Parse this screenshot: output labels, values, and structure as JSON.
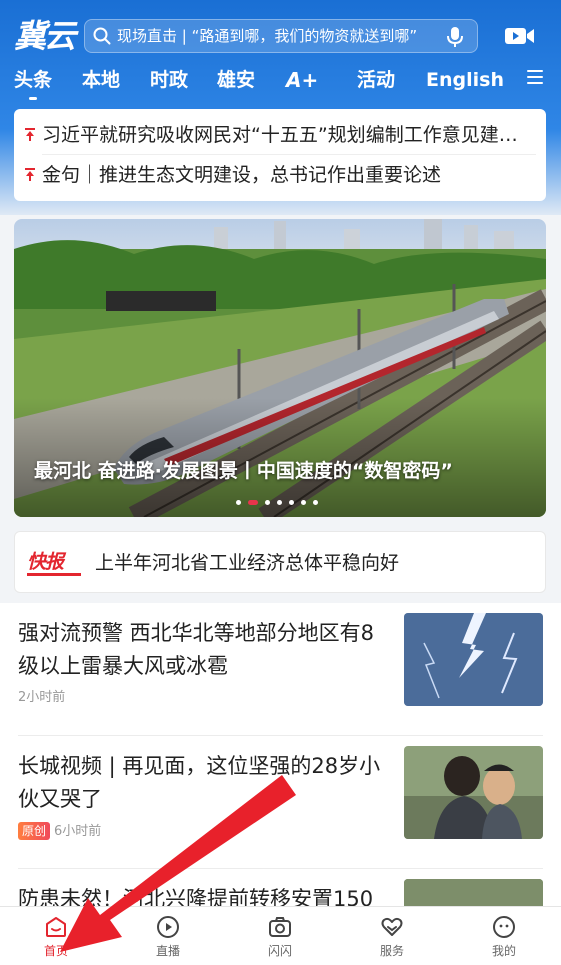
{
  "header": {
    "logo_text": "冀云",
    "search_placeholder": "现场直击 | “路通到哪，我们的物资就送到哪”",
    "tabs": [
      {
        "label": "头条",
        "active": true
      },
      {
        "label": "本地"
      },
      {
        "label": "时政"
      },
      {
        "label": "雄安"
      },
      {
        "label": "A+"
      },
      {
        "label": "活动"
      },
      {
        "label": "English"
      }
    ]
  },
  "top_news": [
    {
      "text": "习近平就研究吸收网民对“十五五”规划编制工作意见建议作出重要指示"
    },
    {
      "text": "金句｜推进生态文明建设，总书记作出重要论述"
    }
  ],
  "banner": {
    "caption": "最河北 奋进路·发展图景丨中国速度的“数智密码”",
    "slides": 7,
    "active_slide": 1
  },
  "flash": {
    "badge": "快报",
    "text": "上半年河北省工业经济总体平稳向好"
  },
  "news": [
    {
      "title": "强对流预警 西北华北等地部分地区有8级以上雷暴大风或冰雹",
      "time": "2小时前",
      "badge": ""
    },
    {
      "title": "长城视频 | 再见面，这位坚强的28岁小伙又哭了",
      "time": "6小时前",
      "badge": "原创"
    },
    {
      "title": "防患未然！河北兴隆提前转移安置150",
      "time": "",
      "badge": ""
    }
  ],
  "bottom_nav": [
    {
      "label": "首页",
      "icon": "home-icon",
      "active": true
    },
    {
      "label": "直播",
      "icon": "play-icon"
    },
    {
      "label": "闪闪",
      "icon": "camera-icon"
    },
    {
      "label": "服务",
      "icon": "heart-hands-icon"
    },
    {
      "label": "我的",
      "icon": "smile-icon"
    }
  ],
  "colors": {
    "brand_blue": "#1a6fd4",
    "accent_red": "#e3262f"
  }
}
